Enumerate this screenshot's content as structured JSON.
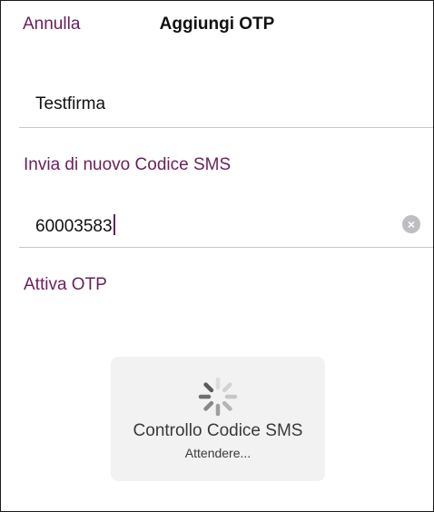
{
  "navbar": {
    "cancel_label": "Annulla",
    "title": "Aggiungi OTP"
  },
  "form": {
    "name_value": "Testfirma",
    "resend_label": "Invia di nuovo Codice SMS",
    "code_value": "60003583",
    "activate_label": "Attiva OTP"
  },
  "hud": {
    "title": "Controllo Codice SMS",
    "subtitle": "Attendere..."
  },
  "colors": {
    "accent": "#6b1e5c",
    "divider": "#c8c7cc",
    "hud_background": "#f2f2f3"
  },
  "icons": {
    "clear": "clear-circle-icon",
    "spinner": "loading-spinner-icon"
  }
}
